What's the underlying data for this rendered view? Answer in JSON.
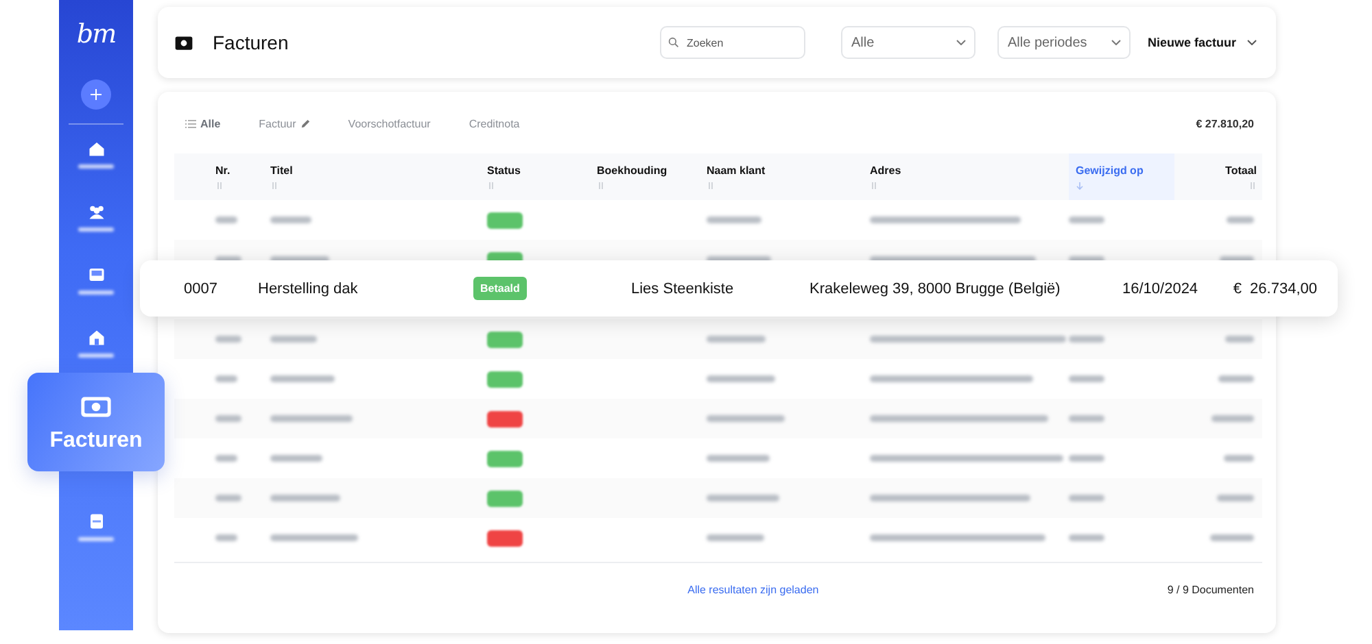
{
  "sidebar": {
    "logo": "bm",
    "items": [
      {
        "kind": "home",
        "selected": false
      },
      {
        "kind": "people",
        "selected": false
      },
      {
        "kind": "inbox",
        "selected": false
      },
      {
        "kind": "house",
        "selected": false
      },
      {
        "kind": "invoice",
        "label": "Facturen",
        "selected": true
      },
      {
        "kind": "book",
        "selected": false
      }
    ]
  },
  "header": {
    "title": "Facturen",
    "search": {
      "placeholder": "Zoeken"
    },
    "filters": [
      "Alle",
      "Alle periodes"
    ],
    "new_button": "Nieuwe factuur"
  },
  "tabs": [
    {
      "label": "Alle",
      "kind": "list",
      "selected": true
    },
    {
      "label": "Factuur",
      "kind": "pencil",
      "selected": false
    },
    {
      "label": "Voorschotfactuur",
      "kind": "plain",
      "selected": false
    },
    {
      "label": "Creditnota",
      "kind": "plain",
      "selected": false
    }
  ],
  "grand_total": "€ 27.810,20",
  "table": {
    "columns": [
      {
        "label": "Nr.",
        "sorted": false
      },
      {
        "label": "Titel",
        "sorted": false
      },
      {
        "label": "Status",
        "sorted": false
      },
      {
        "label": "Boekhouding",
        "sorted": false
      },
      {
        "label": "Naam klant",
        "sorted": false
      },
      {
        "label": "Adres",
        "sorted": false
      },
      {
        "label": "Gewijzigd op",
        "sorted": true
      },
      {
        "label": "Totaal",
        "sorted": false
      }
    ],
    "rows": [
      {
        "kind": "blurred",
        "color": "#5cc36a"
      },
      {
        "kind": "blurred",
        "color": "#5cc36a"
      },
      {
        "kind": "highlight",
        "nr": "0007",
        "title": "Herstelling dak",
        "status": "Betaald",
        "color": "#5cc36a",
        "client": "Lies Steenkiste",
        "address": "Krakeleweg 39, 8000 Brugge (België)",
        "modified": "16/10/2024",
        "total": "€  26.734,00"
      },
      {
        "kind": "blurred",
        "color": "#5cc36a"
      },
      {
        "kind": "blurred",
        "color": "#5cc36a"
      },
      {
        "kind": "blurred",
        "color": "#ef4444"
      },
      {
        "kind": "blurred",
        "color": "#5cc36a"
      },
      {
        "kind": "blurred",
        "color": "#5cc36a"
      },
      {
        "kind": "blurred",
        "color": "#ef4444"
      }
    ]
  },
  "footer": {
    "status": "Alle resultaten zijn geladen",
    "count": "9 / 9 Documenten"
  }
}
